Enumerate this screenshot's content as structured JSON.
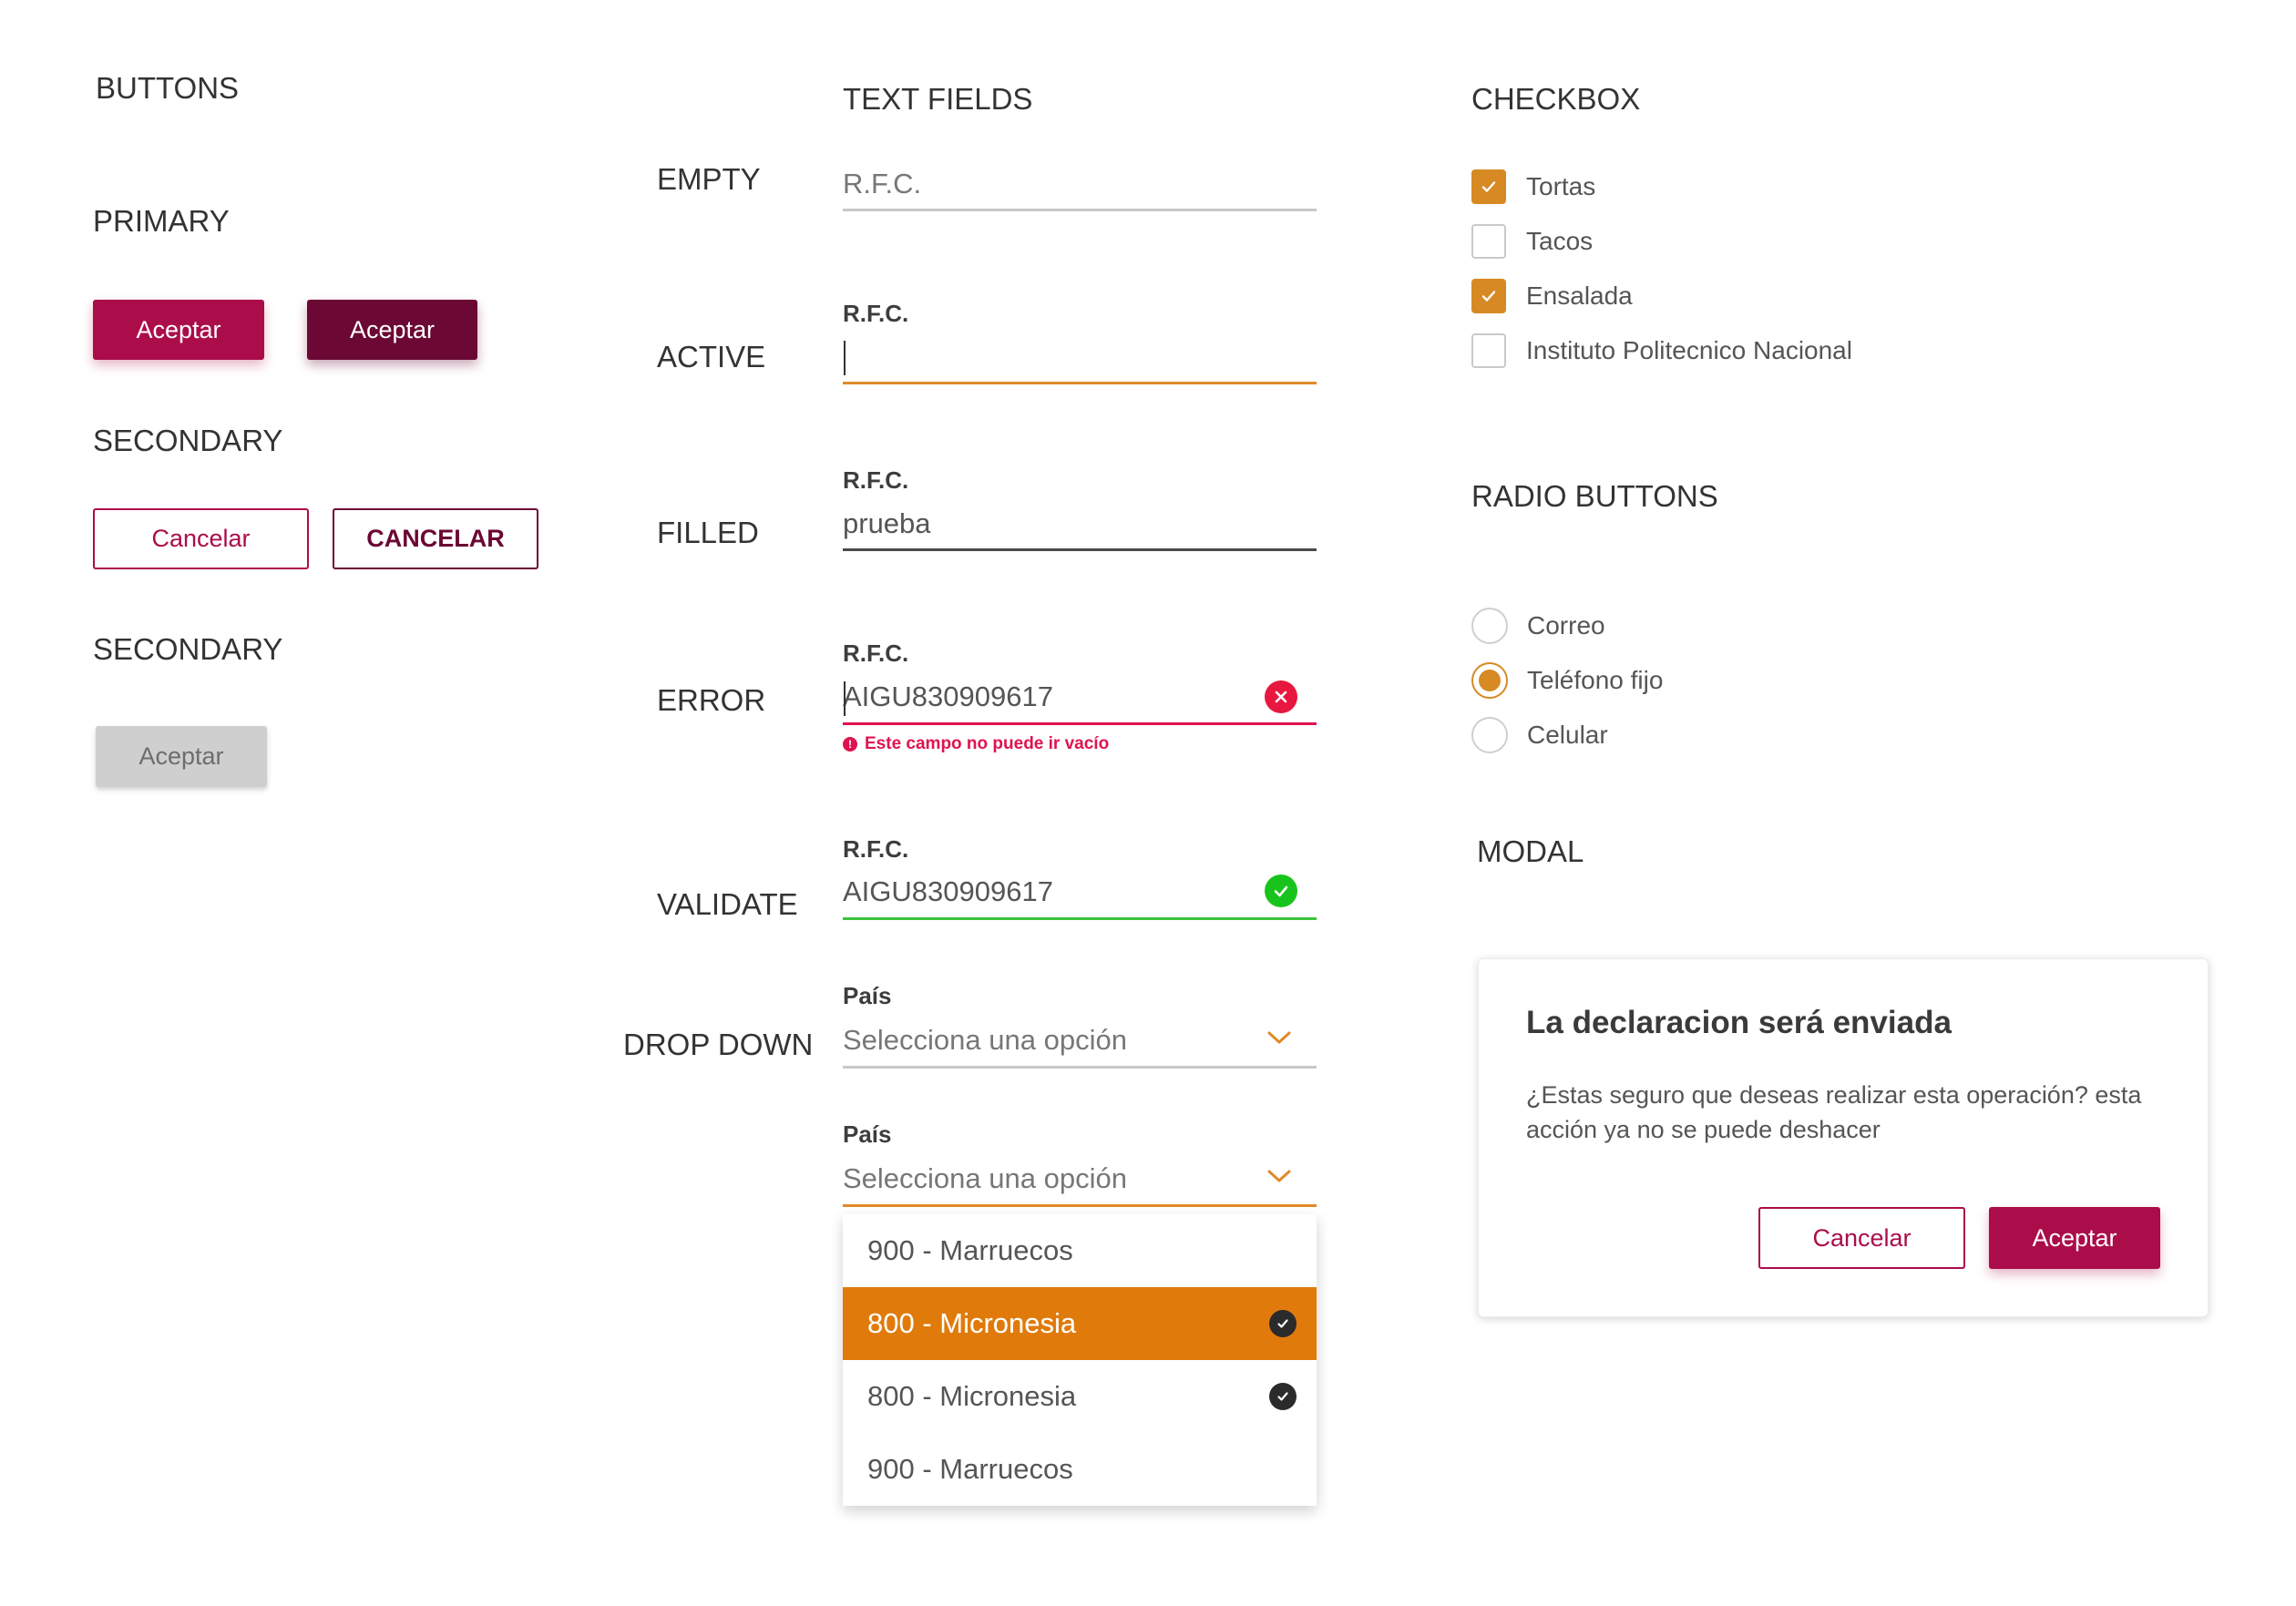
{
  "buttons": {
    "heading": "BUTTONS",
    "primary_heading": "PRIMARY",
    "primary_label": "Aceptar",
    "primary_pressed_label": "Aceptar",
    "secondary_heading": "SECONDARY",
    "secondary_label": "Cancelar",
    "secondary_upper_label": "CANCELAR",
    "disabled_heading": "SECONDARY",
    "disabled_label": "Aceptar"
  },
  "text_fields": {
    "heading": "TEXT FIELDS",
    "empty": {
      "state": "EMPTY",
      "placeholder": "R.F.C."
    },
    "active": {
      "state": "ACTIVE",
      "label": "R.F.C.",
      "value": ""
    },
    "filled": {
      "state": "FILLED",
      "label": "R.F.C.",
      "value": "prueba"
    },
    "error": {
      "state": "ERROR",
      "label": "R.F.C.",
      "value": "AIGU830909617",
      "message": "Este campo no puede ir vacío",
      "icon": "error-x-icon"
    },
    "validate": {
      "state": "VALIDATE",
      "label": "R.F.C.",
      "value": "AIGU830909617",
      "icon": "check-circle-icon"
    }
  },
  "dropdown": {
    "state": "DROP DOWN",
    "closed": {
      "label": "País",
      "placeholder": "Selecciona una opción"
    },
    "open": {
      "label": "País",
      "placeholder": "Selecciona una opción",
      "options": [
        {
          "label": "900 - Marruecos",
          "selected": false,
          "checked": false
        },
        {
          "label": "800 - Micronesia",
          "selected": true,
          "checked": true
        },
        {
          "label": "800 - Micronesia",
          "selected": false,
          "checked": true
        },
        {
          "label": "900 - Marruecos",
          "selected": false,
          "checked": false
        }
      ]
    }
  },
  "checkbox": {
    "heading": "CHECKBOX",
    "items": [
      {
        "label": "Tortas",
        "checked": true
      },
      {
        "label": "Tacos",
        "checked": false
      },
      {
        "label": "Ensalada",
        "checked": true
      },
      {
        "label": "Instituto Politecnico Nacional",
        "checked": false
      }
    ]
  },
  "radio": {
    "heading": "RADIO BUTTONS",
    "items": [
      {
        "label": "Correo",
        "checked": false
      },
      {
        "label": "Teléfono fijo",
        "checked": true
      },
      {
        "label": "Celular",
        "checked": false
      }
    ]
  },
  "modal": {
    "heading": "MODAL",
    "title": "La declaracion será enviada",
    "body": "¿Estas seguro que deseas realizar esta operación? esta acción ya no se puede deshacer",
    "cancel_label": "Cancelar",
    "accept_label": "Aceptar"
  },
  "colors": {
    "primary": "#ab0d4a",
    "primary_dark": "#6b0834",
    "accent": "#e07b0b",
    "checkbox": "#d78a23",
    "error": "#e0134f",
    "success": "#18c41c"
  }
}
